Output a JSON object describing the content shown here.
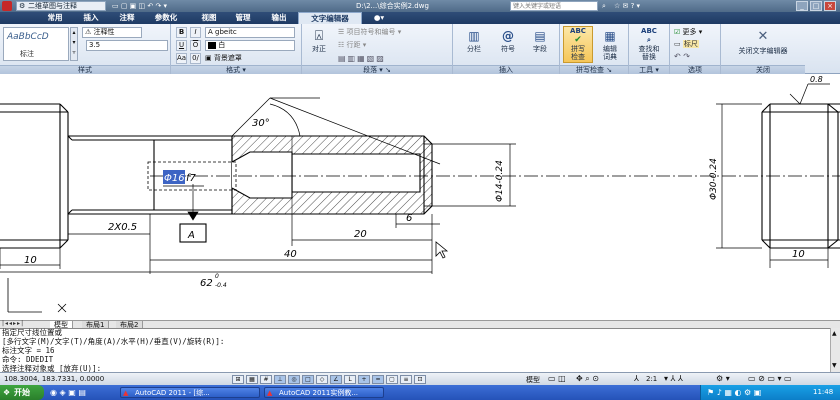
{
  "window": {
    "workspace": "二维草图与注释",
    "title": "D:\\2...\\综合实例2.dwg",
    "search_placeholder": "键入关键字或短语"
  },
  "tabs": [
    "常用",
    "插入",
    "注释",
    "参数化",
    "视图",
    "管理",
    "输出",
    "文字编辑器"
  ],
  "active_tab_index": 7,
  "ribbon": {
    "style_panel": {
      "title": "样式",
      "style_preview": "AaBbCcD",
      "style_name": "标注",
      "annotative_label": "注释性",
      "height_value": "3.5"
    },
    "format_panel": {
      "title": "格式",
      "bold": "B",
      "italic": "I",
      "underline": "U",
      "overline": "O",
      "font": "gbeitc",
      "color": "白",
      "background_mask": "背景遮罩"
    },
    "paragraph_panel": {
      "title": "段落",
      "justify_label": "对正",
      "bullets_label": "项目符号和编号",
      "line_spacing_label": "行距"
    },
    "insert_panel": {
      "title": "插入",
      "columns_label": "分栏",
      "symbol_label": "符号",
      "field_label": "字段"
    },
    "spell_panel": {
      "title": "拼写检查",
      "spell_label": "拼写\n检查",
      "dictionary_label": "编辑\n词典"
    },
    "tools_panel": {
      "title": "工具",
      "find_label": "查找和\n替换"
    },
    "options_panel": {
      "title": "选项",
      "more_label": "更多",
      "ruler_label": "标尺"
    },
    "close_panel": {
      "title": "关闭",
      "close_label": "关闭文字编辑器"
    }
  },
  "drawing": {
    "dim_30deg": "30°",
    "dim_2x05": "2X0.5",
    "dim_10_left": "10",
    "dim_40": "40",
    "dim_20": "20",
    "dim_6": "6",
    "dim_62": "62",
    "dim_62_tol": "0",
    "dim_62_tol_low": "-0.4",
    "dim_phi14": "Φ14-0.24",
    "dim_phi30": "Φ30-0.24",
    "dim_10_right": "10",
    "datum": "A",
    "edit_text_sel": "Φ16",
    "edit_text_rest": "f7",
    "roughness": "0.8"
  },
  "layout_tabs": [
    "模型",
    "布局1",
    "布局2"
  ],
  "command_lines": [
    "指定尺寸线位置或",
    "[多行文字(M)/文字(T)/角度(A)/水平(H)/垂直(V)/旋转(R)]:",
    "标注文字 = 16",
    "命令: DDEDIT",
    "选择注释对象或 [放弃(U)]:"
  ],
  "status": {
    "coords": "108.3004, 183.7331, 0.0000",
    "model_label": "模型",
    "scale": "2:1"
  },
  "taskbar": {
    "start": "开始",
    "task1": "AutoCAD 2011 - [综...",
    "task2": "AutoCAD 2011实例教...",
    "time": "11:48"
  }
}
